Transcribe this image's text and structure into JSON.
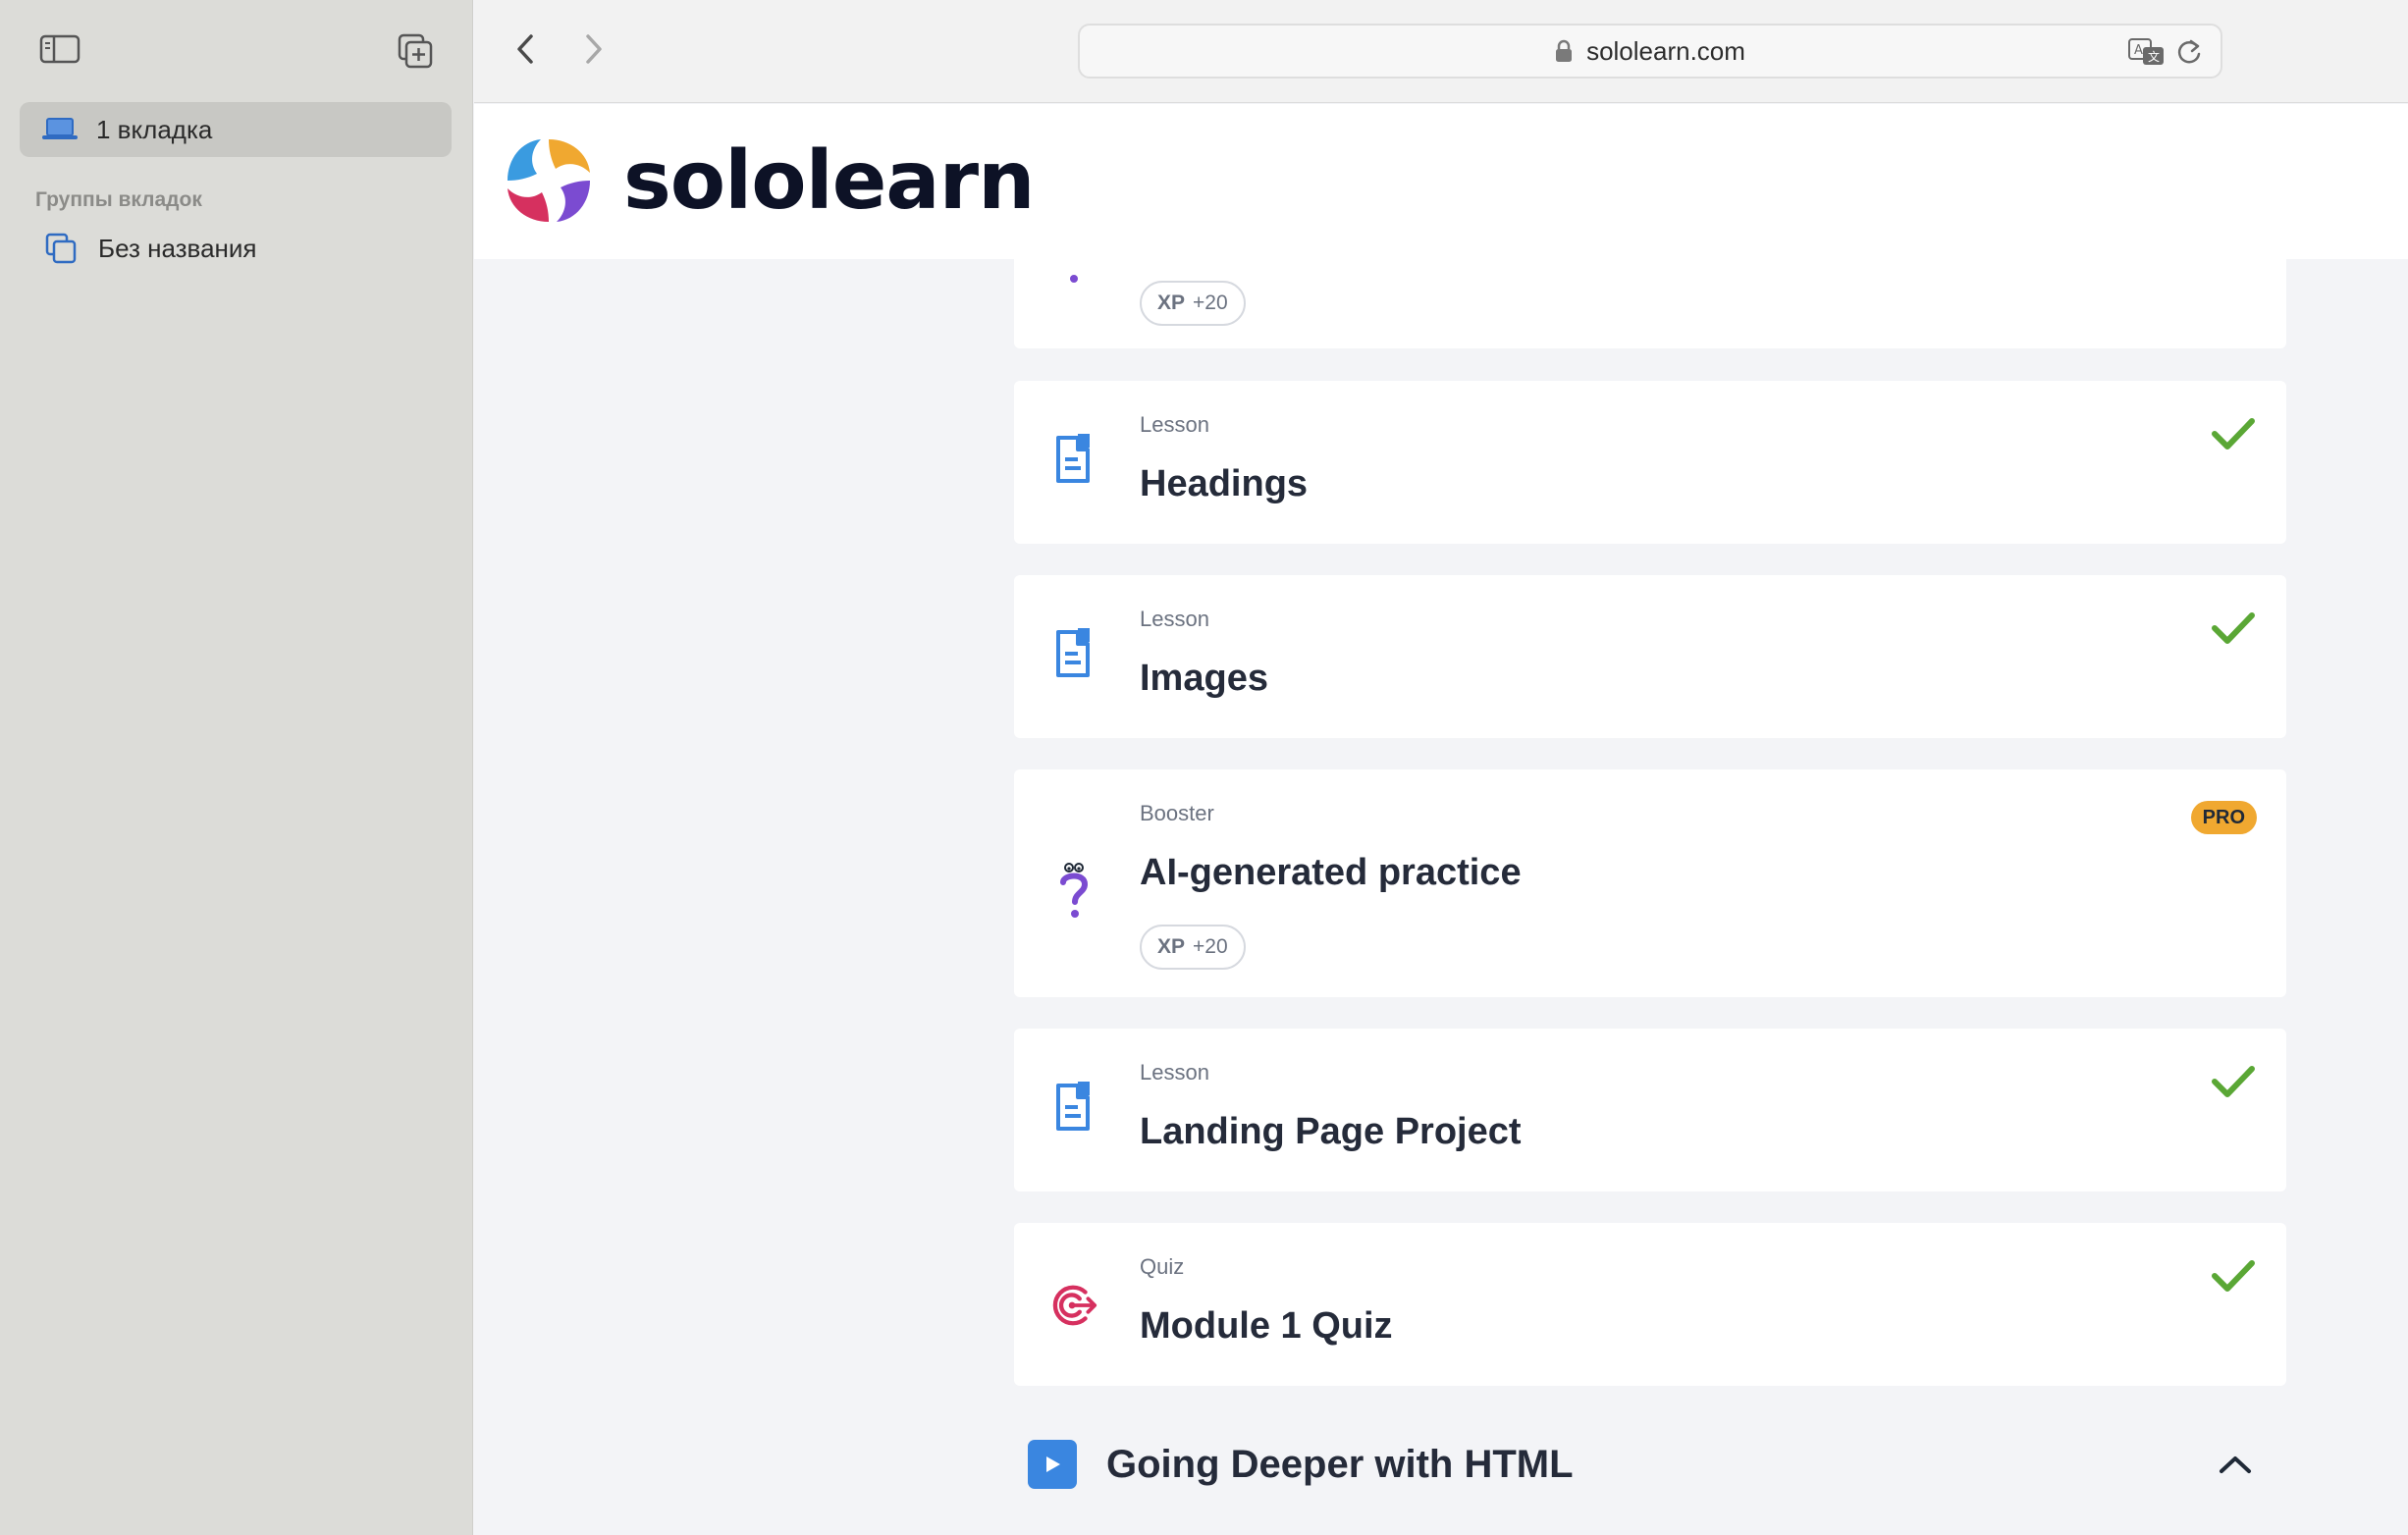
{
  "sidebar": {
    "current_tab_label": "1 вкладка",
    "section_label": "Группы вкладок",
    "groups": [
      {
        "label": "Без названия"
      }
    ]
  },
  "toolbar": {
    "url": "sololearn.com"
  },
  "site": {
    "brand": "sololearn"
  },
  "lessons": [
    {
      "kind": "",
      "title": "",
      "xp_label": "XP",
      "xp_points": "+20"
    },
    {
      "kind": "Lesson",
      "title": "Headings",
      "completed": true
    },
    {
      "kind": "Lesson",
      "title": "Images",
      "completed": true
    },
    {
      "kind": "Booster",
      "title": "AI-generated practice",
      "badge": "PRO",
      "xp_label": "XP",
      "xp_points": "+20"
    },
    {
      "kind": "Lesson",
      "title": "Landing Page Project",
      "completed": true
    },
    {
      "kind": "Quiz",
      "title": "Module 1 Quiz",
      "completed": true
    }
  ],
  "next_section": {
    "title": "Going Deeper with HTML"
  },
  "colors": {
    "check": "#5aa735",
    "lesson_icon": "#3a86e0",
    "quiz_icon": "#d6305f",
    "booster_icon": "#7b4bd1",
    "pro_badge": "#f0a830"
  }
}
